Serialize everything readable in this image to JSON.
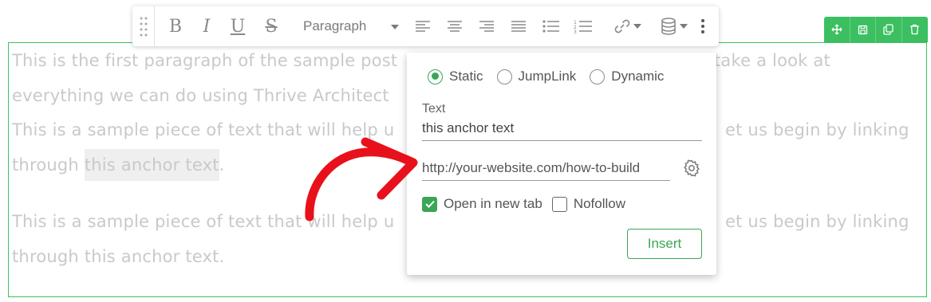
{
  "content": {
    "lines": [
      "This is the first paragraph of the sample post",
      "take a look at",
      "everything we can do using Thrive Architect",
      "This is a sample piece of text that will help u",
      "et us begin by linking",
      "through ",
      "this anchor text",
      ".",
      "This is a sample piece of text that will help u",
      "et us begin by linking",
      "through this anchor text."
    ]
  },
  "toolbar": {
    "paragraph_select": "Paragraph",
    "icons": [
      "drag-handle-icon",
      "bold-icon",
      "italic-icon",
      "underline-icon",
      "strikethrough-icon",
      "align-left-icon",
      "align-center-icon",
      "align-right-icon",
      "align-justify-icon",
      "bulleted-list-icon",
      "numbered-list-icon",
      "link-icon",
      "database-icon",
      "more-vertical-icon"
    ]
  },
  "element_controls": {
    "color": "#3bbf61",
    "icons": [
      "move-icon",
      "save-icon",
      "duplicate-icon",
      "delete-icon"
    ]
  },
  "link_popup": {
    "radio_options": [
      "Static",
      "JumpLink",
      "Dynamic"
    ],
    "selected_radio": "Static",
    "text_label": "Text",
    "text_value": "this anchor text",
    "url_value": "http://your-website.com/how-to-build",
    "checkboxes": [
      {
        "label": "Open in new tab",
        "checked": true
      },
      {
        "label": "Nofollow",
        "checked": false
      }
    ],
    "insert_label": "Insert",
    "accent_color": "#3aa655"
  },
  "annotation": {
    "arrow_color": "#e8111b"
  }
}
